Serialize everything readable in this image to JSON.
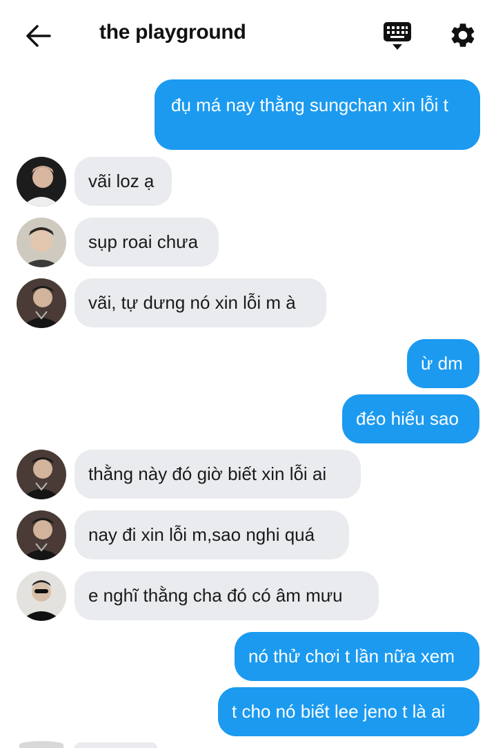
{
  "header": {
    "title": "the playground",
    "back_icon": "back-arrow-icon",
    "keyboard_icon": "keyboard-icon",
    "settings_icon": "gear-icon"
  },
  "colors": {
    "outgoing_bubble": "#1b9af0",
    "incoming_bubble": "#e9ebee",
    "outgoing_text": "#ffffff",
    "incoming_text": "#1a1a1a"
  },
  "messages": [
    {
      "direction": "out",
      "text": "đụ má nay thằng sungchan xin lỗi t"
    },
    {
      "direction": "in",
      "text": "vãi loz ạ"
    },
    {
      "direction": "in",
      "text": "sụp roai chưa"
    },
    {
      "direction": "in",
      "text": "vãi, tự dưng nó xin lỗi m à"
    },
    {
      "direction": "out",
      "text": "ừ dm"
    },
    {
      "direction": "out",
      "text": "đéo hiểu sao"
    },
    {
      "direction": "in",
      "text": "thằng này đó giờ biết xin lỗi ai"
    },
    {
      "direction": "in",
      "text": "nay đi xin lỗi m,sao nghi quá"
    },
    {
      "direction": "in",
      "text": "e nghĩ thằng cha đó có âm mưu"
    },
    {
      "direction": "out",
      "text": "nó thử chơi t lần nữa xem"
    },
    {
      "direction": "out",
      "text": "t cho nó biết lee jeno t là ai"
    }
  ]
}
